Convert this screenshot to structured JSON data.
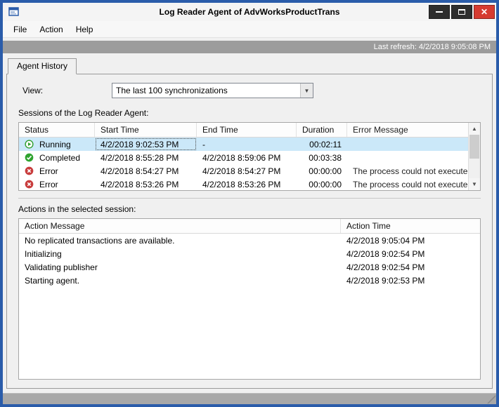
{
  "window": {
    "title": "Log Reader Agent of AdvWorksProductTrans",
    "last_refresh": "Last refresh: 4/2/2018 9:05:08 PM"
  },
  "menu": {
    "items": [
      "File",
      "Action",
      "Help"
    ]
  },
  "tabs": [
    {
      "label": "Agent History"
    }
  ],
  "view": {
    "label": "View:",
    "value": "The last 100 synchronizations"
  },
  "icons": {
    "dropdown_arrow": "▼",
    "scroll_up": "▲",
    "scroll_down": "▼",
    "close_glyph": "✕"
  },
  "sessions": {
    "heading": "Sessions of the Log Reader Agent:",
    "columns": [
      "Status",
      "Start Time",
      "End Time",
      "Duration",
      "Error Message"
    ],
    "rows": [
      {
        "status": "Running",
        "icon": "running-icon",
        "start": "4/2/2018 9:02:53 PM",
        "end": "-",
        "duration": "00:02:11",
        "error": "",
        "selected": true
      },
      {
        "status": "Completed",
        "icon": "completed-icon",
        "start": "4/2/2018 8:55:28 PM",
        "end": "4/2/2018 8:59:06 PM",
        "duration": "00:03:38",
        "error": "",
        "selected": false
      },
      {
        "status": "Error",
        "icon": "error-icon",
        "start": "4/2/2018 8:54:27 PM",
        "end": "4/2/2018 8:54:27 PM",
        "duration": "00:00:00",
        "error": "The process could not execute '...",
        "selected": false
      },
      {
        "status": "Error",
        "icon": "error-icon",
        "start": "4/2/2018 8:53:26 PM",
        "end": "4/2/2018 8:53:26 PM",
        "duration": "00:00:00",
        "error": "The process could not execute '...",
        "selected": false
      }
    ]
  },
  "actions": {
    "heading": "Actions in the selected session:",
    "columns": [
      "Action Message",
      "Action Time"
    ],
    "rows": [
      {
        "message": "No replicated transactions are available.",
        "time": "4/2/2018 9:05:04 PM"
      },
      {
        "message": "Initializing",
        "time": "4/2/2018 9:02:54 PM"
      },
      {
        "message": "Validating publisher",
        "time": "4/2/2018 9:02:54 PM"
      },
      {
        "message": "Starting agent.",
        "time": "4/2/2018 9:02:53 PM"
      }
    ]
  },
  "colors": {
    "window_border": "#2a5caa",
    "close_button": "#d63b30",
    "selected_row": "#cbe8f9",
    "refresh_strip": "#9c9c9c",
    "status_running": "#2e9e2e",
    "status_completed": "#2fa32f",
    "status_error": "#c83c3c"
  }
}
